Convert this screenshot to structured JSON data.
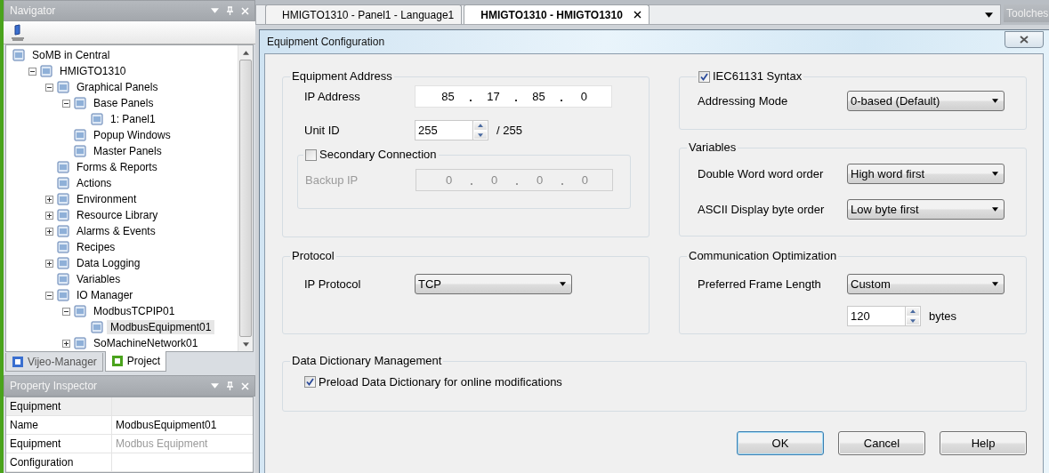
{
  "navigator": {
    "title": "Navigator",
    "tree": [
      {
        "label": "SoMB in Central",
        "selected": false,
        "children": [
          {
            "label": "HMIGTO1310",
            "selected": false,
            "expanded": true,
            "children": [
              {
                "label": "Graphical Panels",
                "selected": false,
                "expanded": true,
                "children": [
                  {
                    "label": "Base Panels",
                    "selected": false,
                    "expanded": true,
                    "children": [
                      {
                        "label": "1: Panel1",
                        "selected": false
                      }
                    ]
                  },
                  {
                    "label": "Popup Windows",
                    "selected": false
                  },
                  {
                    "label": "Master Panels",
                    "selected": false
                  }
                ]
              },
              {
                "label": "Forms & Reports",
                "selected": false
              },
              {
                "label": "Actions",
                "selected": false
              },
              {
                "label": "Environment",
                "selected": false,
                "expanded": false
              },
              {
                "label": "Resource Library",
                "selected": false,
                "expanded": false
              },
              {
                "label": "Alarms & Events",
                "selected": false,
                "expanded": false
              },
              {
                "label": "Recipes",
                "selected": false
              },
              {
                "label": "Data Logging",
                "selected": false,
                "expanded": false
              },
              {
                "label": "Variables",
                "selected": false
              },
              {
                "label": "IO Manager",
                "selected": false,
                "expanded": true,
                "children": [
                  {
                    "label": "ModbusTCPIP01",
                    "selected": false,
                    "expanded": true,
                    "children": [
                      {
                        "label": "ModbusEquipment01",
                        "selected": true
                      }
                    ]
                  },
                  {
                    "label": "SoMachineNetwork01",
                    "selected": false,
                    "expanded": false
                  }
                ]
              }
            ]
          }
        ]
      }
    ],
    "tabs": [
      {
        "label": "Vijeo-Manager",
        "selected": false
      },
      {
        "label": "Project",
        "selected": true
      }
    ]
  },
  "property_inspector": {
    "title": "Property Inspector",
    "rows": [
      {
        "kind": "category",
        "name": "Equipment"
      },
      {
        "kind": "property",
        "name": "Name",
        "value": "ModbusEquipment01",
        "disabled": false
      },
      {
        "kind": "property",
        "name": "Equipment",
        "value": "Modbus Equipment",
        "disabled": true
      },
      {
        "kind": "group",
        "name": "Configuration"
      }
    ]
  },
  "document_tabs": [
    {
      "label": "HMIGTO1310 - Panel1 - Language1",
      "selected": false,
      "closable": false
    },
    {
      "label": "HMIGTO1310 - HMIGTO1310",
      "selected": true,
      "closable": true
    }
  ],
  "toolchest": {
    "title": "Toolches"
  },
  "dialog": {
    "title": "Equipment Configuration",
    "equipment_address": {
      "title": "Equipment Address",
      "ip_address": {
        "label": "IP Address",
        "octets": [
          "85",
          "17",
          "85",
          "0"
        ]
      },
      "unit_id": {
        "label": "Unit ID",
        "value": "255",
        "max": "/ 255"
      },
      "secondary_connection": {
        "label": "Secondary Connection",
        "checked": false,
        "backup_ip": {
          "label": "Backup IP",
          "octets": [
            "0",
            "0",
            "0",
            "0"
          ],
          "disabled": true
        }
      }
    },
    "protocol": {
      "title": "Protocol",
      "ip_protocol": {
        "label": "IP Protocol",
        "value": "TCP"
      }
    },
    "iec_syntax": {
      "label": "IEC61131 Syntax",
      "checked": true,
      "addressing_mode": {
        "label": "Addressing Mode",
        "value": "0-based (Default)"
      }
    },
    "variables": {
      "title": "Variables",
      "fields": [
        {
          "label": "Double Word word order",
          "value": "High word first"
        },
        {
          "label": "ASCII Display byte order",
          "value": "Low byte first"
        }
      ]
    },
    "communication_optimization": {
      "title": "Communication Optimization",
      "preferred_frame_length": {
        "label": "Preferred Frame Length",
        "value": "Custom"
      },
      "frame_size": {
        "value": "120",
        "unit": "bytes"
      }
    },
    "data_dictionary": {
      "title": "Data Dictionary Management",
      "preload": {
        "label": "Preload Data Dictionary for online modifications",
        "checked": true
      }
    },
    "buttons": [
      {
        "label": "OK",
        "default": true
      },
      {
        "label": "Cancel",
        "default": false
      },
      {
        "label": "Help",
        "default": false
      }
    ]
  }
}
